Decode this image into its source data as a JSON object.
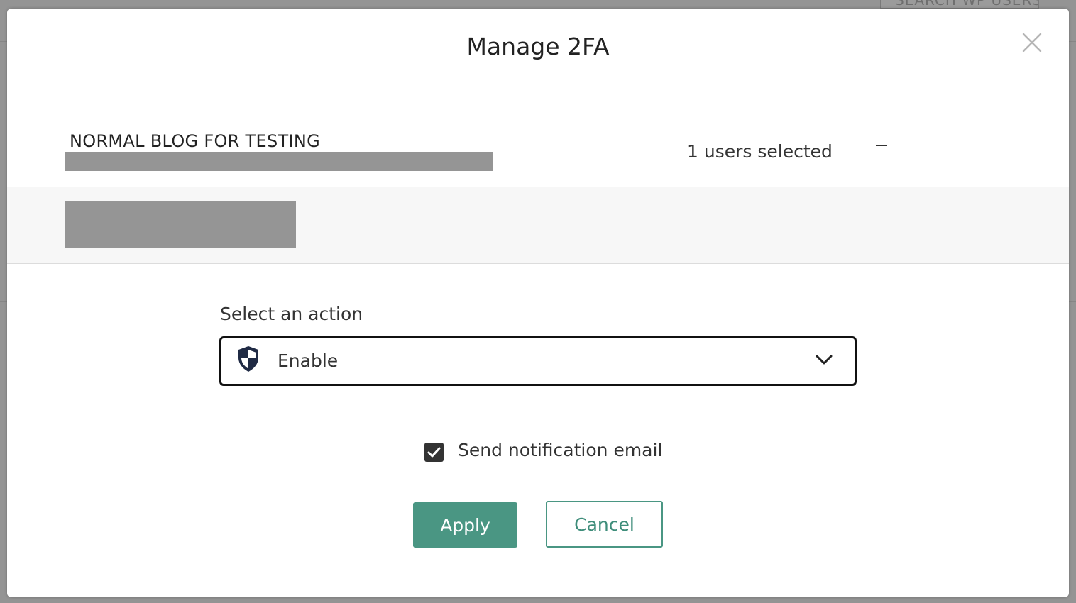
{
  "background": {
    "search_button_label": "SEARCH WP USERS"
  },
  "modal": {
    "title": "Manage 2FA",
    "close_icon": "close-icon"
  },
  "site": {
    "name": "NORMAL BLOG FOR TESTING",
    "users_selected": "1 users selected",
    "collapse_symbol": "−"
  },
  "action": {
    "label": "Select an action",
    "selected_value": "Enable",
    "selected_icon": "shield-icon",
    "dropdown_icon": "chevron-down-icon"
  },
  "notification": {
    "label": "Send notification email",
    "checked": true
  },
  "buttons": {
    "apply_label": "Apply",
    "cancel_label": "Cancel"
  },
  "colors": {
    "accent": "#4a9683",
    "shield_dark": "#1f2a44",
    "overlay": "#949494"
  }
}
